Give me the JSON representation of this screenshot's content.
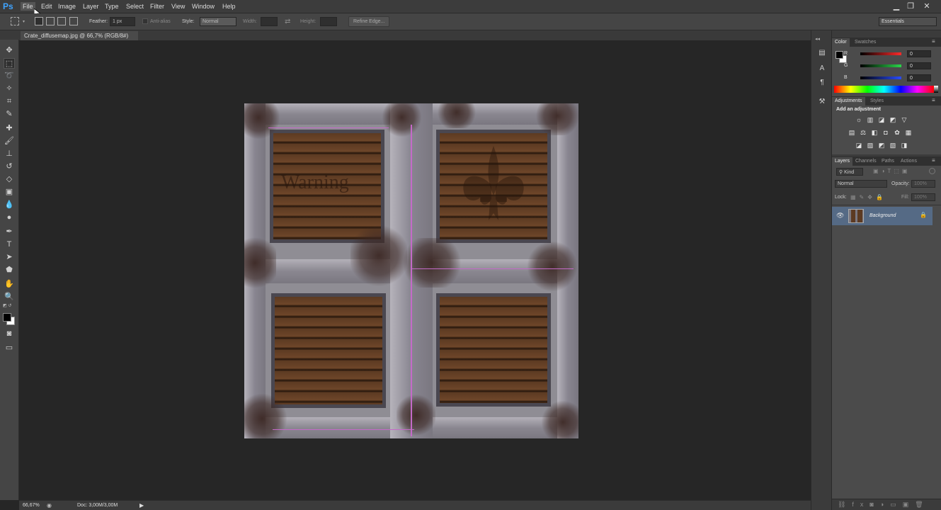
{
  "app": {
    "logo": "Ps"
  },
  "menu": [
    "File",
    "Edit",
    "Image",
    "Layer",
    "Type",
    "Select",
    "Filter",
    "View",
    "Window",
    "Help"
  ],
  "options": {
    "feather_label": "Feather:",
    "feather_value": "1 px",
    "anti_alias_label": "Anti-alias",
    "style_label": "Style:",
    "style_value": "Normal",
    "width_label": "Width:",
    "height_label": "Height:",
    "refine_edge": "Refine Edge...",
    "workspace": "Essentials"
  },
  "document": {
    "tab_title": "Crate_diffusemap.jpg @ 66,7% (RGB/8#)",
    "close_glyph": "×",
    "crate_text": "Warning"
  },
  "status": {
    "zoom": "66,67%",
    "doc_size": "Doc: 3,00M/3,00M"
  },
  "color_panel": {
    "tabs": [
      "Color",
      "Swatches"
    ],
    "channels": [
      {
        "label": "R",
        "value": "0",
        "color": "#e03030"
      },
      {
        "label": "G",
        "value": "0",
        "color": "#30c040"
      },
      {
        "label": "B",
        "value": "0",
        "color": "#3050e0"
      }
    ]
  },
  "adjustments_panel": {
    "tabs": [
      "Adjustments",
      "Styles"
    ],
    "heading": "Add an adjustment"
  },
  "layers_panel": {
    "tabs": [
      "Layers",
      "Channels",
      "Paths",
      "Actions"
    ],
    "kind_label": "Kind",
    "blend_mode": "Normal",
    "opacity_label": "Opacity:",
    "opacity_value": "100%",
    "lock_label": "Lock:",
    "fill_label": "Fill:",
    "fill_value": "100%",
    "layers": [
      {
        "name": "Background",
        "visible": true,
        "locked": true
      }
    ]
  },
  "colors": {
    "accent_logo": "#3fa3ff",
    "guide": "#c46ac8",
    "layer_selected": "#556a85"
  }
}
